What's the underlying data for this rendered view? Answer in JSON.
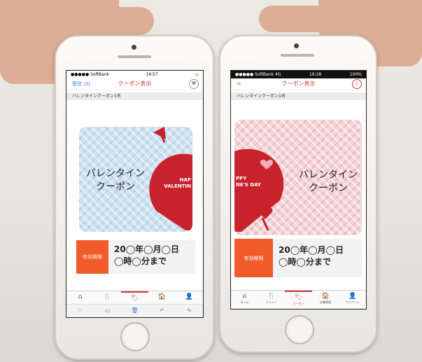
{
  "left_phone": {
    "status_carrier": "●●●●● SoftBank",
    "status_time": "14:57",
    "back_label": "受信 (0)",
    "nav_title": "クーポン表示",
    "coupon_name": "バレンタインクーポン1名",
    "coupon_title_line1": "バレンタイン",
    "coupon_title_line2": "クーポン",
    "heart_text_line1": "HAP",
    "heart_text_line2": "VALENTIN",
    "valid_label": "有効期限",
    "valid_line1": "20◯年◯月◯日",
    "valid_line2": "◯時◯分まで",
    "tabs": [
      "⌂",
      "🍴",
      "🏷",
      "🏠",
      "👤"
    ],
    "toolbar": [
      "⚐",
      "▭",
      "🗑",
      "↶",
      "✎"
    ]
  },
  "right_phone": {
    "status_carrier": "●●●●● SoftBank 4G",
    "status_time": "19:28",
    "status_battery": "100%",
    "back_label": "<",
    "nav_title": "クーポン表示",
    "info_label": "i",
    "coupon_name": "バレンタインクーポン1名",
    "coupon_title_line1": "バレンタイン",
    "coupon_title_line2": "クーポン",
    "heart_text_line1": "PPY",
    "heart_text_line2": "NE'S DAY",
    "valid_label": "有効期限",
    "valid_line1": "20◯年◯月◯日",
    "valid_line2": "◯時◯分まで",
    "tabs": [
      {
        "icon": "⌂",
        "label": "ホーム"
      },
      {
        "icon": "🍴",
        "label": "メニュー"
      },
      {
        "icon": "🏷",
        "label": "クーポン"
      },
      {
        "icon": "🏠",
        "label": "店舗情報"
      },
      {
        "icon": "👤",
        "label": "マイページ"
      }
    ]
  },
  "colors": {
    "accent": "#d03a3a",
    "badge": "#f15a2b",
    "heart": "#c8232c"
  }
}
